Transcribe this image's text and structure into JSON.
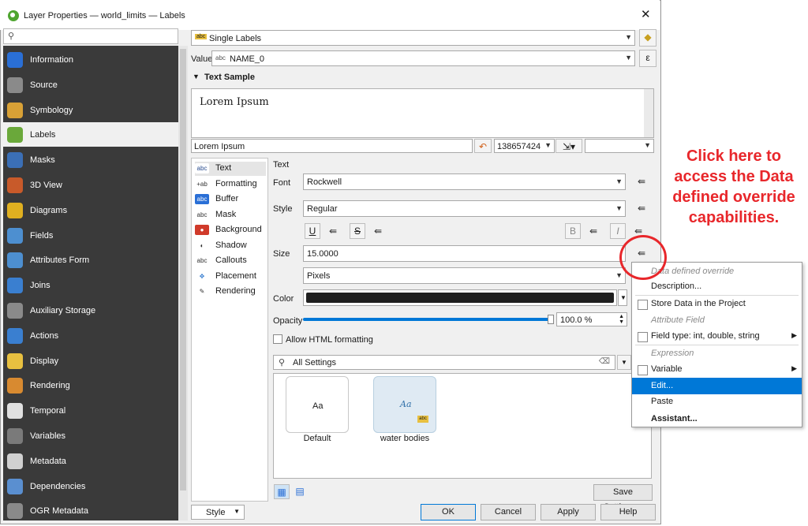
{
  "window": {
    "title": "Layer Properties — world_limits — Labels",
    "close": "✕"
  },
  "sidebar": {
    "search_icon": "⚲",
    "items": [
      {
        "label": "Information",
        "icon": "info-icon",
        "color": "#2a6fd6"
      },
      {
        "label": "Source",
        "icon": "source-icon",
        "color": "#8a8a8a"
      },
      {
        "label": "Symbology",
        "icon": "symbology-icon",
        "color": "#d9a136"
      },
      {
        "label": "Labels",
        "icon": "labels-icon",
        "color": "#6aa83a"
      },
      {
        "label": "Masks",
        "icon": "masks-icon",
        "color": "#3b6fb6"
      },
      {
        "label": "3D View",
        "icon": "3d-view-icon",
        "color": "#c85a2a"
      },
      {
        "label": "Diagrams",
        "icon": "diagrams-icon",
        "color": "#e0b020"
      },
      {
        "label": "Fields",
        "icon": "fields-icon",
        "color": "#4d8fd0"
      },
      {
        "label": "Attributes Form",
        "icon": "attributes-form-icon",
        "color": "#4d8fd0"
      },
      {
        "label": "Joins",
        "icon": "joins-icon",
        "color": "#3a7fd0"
      },
      {
        "label": "Auxiliary Storage",
        "icon": "auxiliary-storage-icon",
        "color": "#8a8a8a"
      },
      {
        "label": "Actions",
        "icon": "actions-icon",
        "color": "#3a7fd0"
      },
      {
        "label": "Display",
        "icon": "display-icon",
        "color": "#e8c040"
      },
      {
        "label": "Rendering",
        "icon": "rendering-icon",
        "color": "#d88a30"
      },
      {
        "label": "Temporal",
        "icon": "temporal-icon",
        "color": "#e0e0e0"
      },
      {
        "label": "Variables",
        "icon": "variables-icon",
        "color": "#7a7a7a"
      },
      {
        "label": "Metadata",
        "icon": "metadata-icon",
        "color": "#d0d0d0"
      },
      {
        "label": "Dependencies",
        "icon": "dependencies-icon",
        "color": "#5a8fd0"
      },
      {
        "label": "OGR Metadata",
        "icon": "ogr-metadata-icon",
        "color": "#8a8a8a"
      }
    ]
  },
  "mode": {
    "value": "Single Labels",
    "badge": "abc"
  },
  "value_row": {
    "label": "Value",
    "badge": "abc",
    "field": "NAME_0",
    "expr_icon": "ε"
  },
  "text_sample": {
    "header": "Text Sample",
    "preview": "Lorem Ipsum",
    "input": "Lorem Ipsum",
    "scale": "138657424"
  },
  "tree": [
    {
      "label": "Text",
      "icon": "abc",
      "color": "#fff",
      "fg": "#2a4d8f"
    },
    {
      "label": "Formatting",
      "icon": "+ab",
      "color": "#fff",
      "fg": "#333"
    },
    {
      "label": "Buffer",
      "icon": "abc",
      "color": "#2a6fd6",
      "fg": "#fff"
    },
    {
      "label": "Mask",
      "icon": "abc",
      "color": "#fff",
      "fg": "#333"
    },
    {
      "label": "Background",
      "icon": "●",
      "color": "#d03a2a",
      "fg": "#fff"
    },
    {
      "label": "Shadow",
      "icon": "◐",
      "color": "#fff",
      "fg": "#333"
    },
    {
      "label": "Callouts",
      "icon": "abc",
      "color": "#fff",
      "fg": "#333"
    },
    {
      "label": "Placement",
      "icon": "✥",
      "color": "#fff",
      "fg": "#3a7fd0"
    },
    {
      "label": "Rendering",
      "icon": "✎",
      "color": "#fff",
      "fg": "#333"
    }
  ],
  "text_panel": {
    "section": "Text",
    "font_label": "Font",
    "font_value": "Rockwell",
    "style_label": "Style",
    "style_value": "Regular",
    "underline": "U",
    "strike": "S",
    "bold": "B",
    "italic": "I",
    "size_label": "Size",
    "size_value": "15.0000",
    "unit_value": "Pixels",
    "color_label": "Color",
    "color_value": "#1f1f1f",
    "opacity_label": "Opacity",
    "opacity_value": "100.0 %",
    "opacity_fraction": 1.0,
    "allow_html": "Allow HTML formatting",
    "search_placeholder": "All Settings",
    "styles": [
      {
        "label": "Default",
        "preview": "Aa"
      },
      {
        "label": "water bodies",
        "preview": "Aa"
      }
    ],
    "save_settings": "Save Settings..."
  },
  "footer": {
    "style": "Style",
    "ok": "OK",
    "cancel": "Cancel",
    "apply": "Apply",
    "help": "Help"
  },
  "context_menu": {
    "items": [
      {
        "label": "Data defined override",
        "kind": "header"
      },
      {
        "label": "Description...",
        "kind": "item"
      },
      {
        "label": "Store Data in the Project",
        "kind": "check"
      },
      {
        "label": "Attribute Field",
        "kind": "header"
      },
      {
        "label": "Field type: int, double, string",
        "kind": "check-sub"
      },
      {
        "label": "Expression",
        "kind": "header"
      },
      {
        "label": "Variable",
        "kind": "check-sub"
      },
      {
        "label": "Edit...",
        "kind": "highlight"
      },
      {
        "label": "Paste",
        "kind": "item"
      },
      {
        "label": "Assistant...",
        "kind": "bold"
      }
    ]
  },
  "annotation": "Click here to access the Data defined override capabilities."
}
